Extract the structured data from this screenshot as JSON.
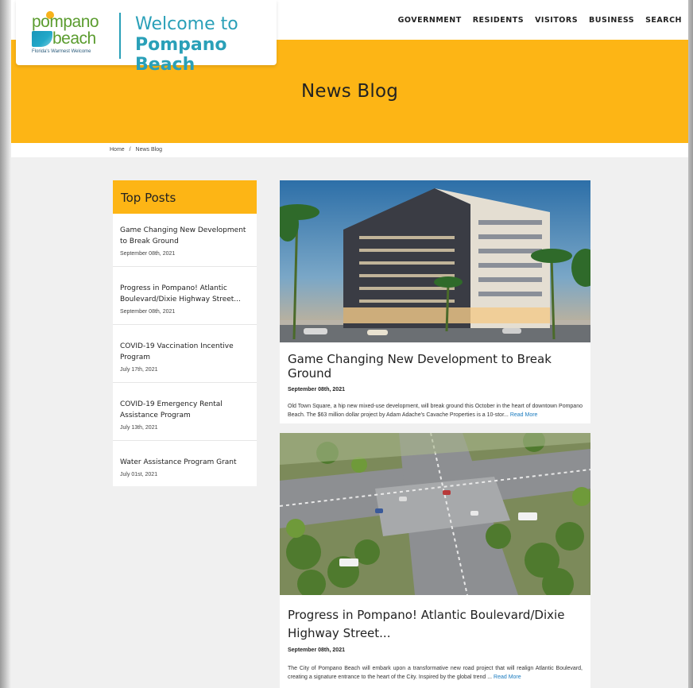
{
  "brand": {
    "logo_line1": "pompano",
    "logo_line2": "beach",
    "logo_tagline": "Florida's Warmest Welcome",
    "welcome_line1": "Welcome to",
    "welcome_line2": "Pompano Beach",
    "accent": "#fdb515",
    "teal": "#2aa0b8"
  },
  "nav": {
    "items": [
      "GOVERNMENT",
      "RESIDENTS",
      "VISITORS",
      "BUSINESS",
      "SEARCH"
    ]
  },
  "hero": {
    "title": "News Blog"
  },
  "breadcrumb": {
    "home": "Home",
    "separator": "/",
    "current": "News Blog"
  },
  "sidebar": {
    "heading": "Top Posts",
    "items": [
      {
        "title": "Game Changing New Development to Break Ground",
        "date": "September 08th, 2021"
      },
      {
        "title": "Progress in Pompano! Atlantic Boulevard/Dixie Highway Street...",
        "date": "September 08th, 2021"
      },
      {
        "title": "COVID-19 Vaccination Incentive Program",
        "date": "July 17th, 2021"
      },
      {
        "title": "COVID-19 Emergency Rental Assistance Program",
        "date": "July 13th, 2021"
      },
      {
        "title": "Water Assistance Program Grant",
        "date": "July 01st, 2021"
      }
    ]
  },
  "posts": [
    {
      "title": "Game Changing New Development to Break Ground",
      "date": "September 08th, 2021",
      "excerpt": "Old Town Square, a hip new mixed-use development, will break ground this October in the heart of downtown Pompano Beach. The $63 million dollar project by Adam Adache's Cavache Properties is a 10-stor... ",
      "read_more": "Read More"
    },
    {
      "title": "Progress in Pompano! Atlantic Boulevard/Dixie Highway Street...",
      "date": "September 08th, 2021",
      "excerpt": "The City of Pompano Beach will embark upon a transformative new road project that will realign Atlantic Boulevard, creating a signature entrance to the heart of the City. Inspired by the global trend ... ",
      "read_more": "Read More"
    }
  ]
}
